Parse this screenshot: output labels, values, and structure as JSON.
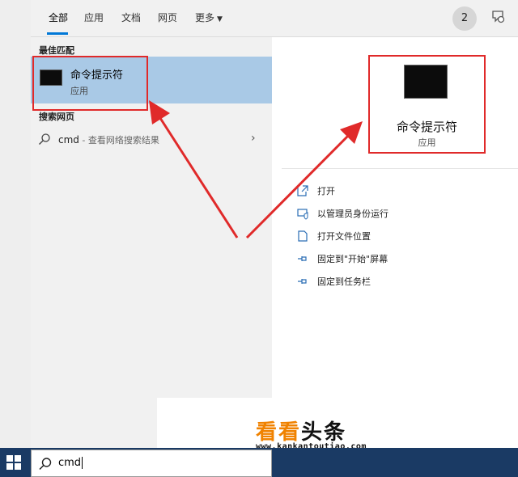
{
  "tabs": [
    {
      "label": "全部",
      "active": true
    },
    {
      "label": "应用"
    },
    {
      "label": "文档"
    },
    {
      "label": "网页"
    }
  ],
  "more_tab": {
    "label": "更多",
    "icon": "chevron-down-icon"
  },
  "header": {
    "badge_count": "2",
    "feedback_icon": "feedback-icon"
  },
  "best_match": {
    "section_title": "最佳匹配",
    "app_name": "命令提示符",
    "app_type": "应用",
    "icon": "terminal-icon"
  },
  "web_search": {
    "section_title": "搜索网页",
    "query": "cmd",
    "suffix": " - 查看网络搜索结果",
    "icon": "search-icon"
  },
  "preview": {
    "title": "命令提示符",
    "subtitle": "应用",
    "icon": "terminal-icon"
  },
  "actions": [
    {
      "label": "打开",
      "icon": "open-icon"
    },
    {
      "label": "以管理员身份运行",
      "icon": "run-as-admin-icon"
    },
    {
      "label": "打开文件位置",
      "icon": "file-location-icon"
    },
    {
      "label": "固定到\"开始\"屏幕",
      "icon": "pin-icon"
    },
    {
      "label": "固定到任务栏",
      "icon": "pin-icon"
    }
  ],
  "watermark": {
    "brand_part1": "看看",
    "brand_part2": "头条",
    "url": "www.kankantoutiao.com",
    "colors": {
      "orange": "#f08200",
      "black": "#111111"
    }
  },
  "taskbar": {
    "search_value": "cmd",
    "start_icon": "windows-logo-icon",
    "search_icon": "search-icon"
  },
  "colors": {
    "selection": "#a9c9e6",
    "accent": "#0078d7",
    "highlight_box": "#e02a2a",
    "taskbar": "#1a3a64"
  }
}
